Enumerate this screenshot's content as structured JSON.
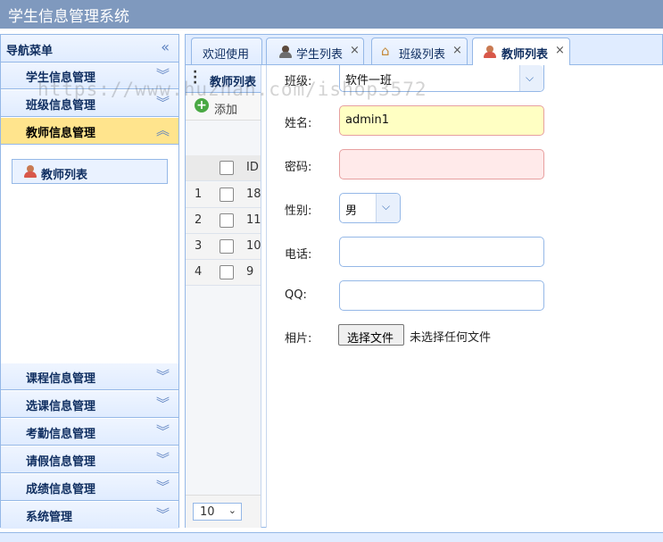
{
  "app": {
    "title": "学生信息管理系统"
  },
  "nav": {
    "header": "导航菜单",
    "top_items": [
      {
        "label": "学生信息管理"
      },
      {
        "label": "班级信息管理"
      },
      {
        "label": "教师信息管理"
      }
    ],
    "active_sub_item": "教师列表",
    "bottom_items": [
      {
        "label": "课程信息管理"
      },
      {
        "label": "选课信息管理"
      },
      {
        "label": "考勤信息管理"
      },
      {
        "label": "请假信息管理"
      },
      {
        "label": "成绩信息管理"
      },
      {
        "label": "系统管理"
      }
    ]
  },
  "tabs": [
    {
      "label": "欢迎使用"
    },
    {
      "label": "学生列表"
    },
    {
      "label": "班级列表"
    },
    {
      "label": "教师列表"
    }
  ],
  "grid": {
    "title": "教师列表",
    "add_label": "添加",
    "id_header": "ID",
    "rows": [
      {
        "num": "1",
        "id": "18"
      },
      {
        "num": "2",
        "id": "11"
      },
      {
        "num": "3",
        "id": "10"
      },
      {
        "num": "4",
        "id": "9"
      }
    ],
    "page_size": "10"
  },
  "form": {
    "class_label": "班级:",
    "class_value": "软件一班",
    "name_label": "姓名:",
    "name_value": "admin1",
    "password_label": "密码:",
    "gender_label": "性别:",
    "gender_value": "男",
    "phone_label": "电话:",
    "qq_label": "QQ:",
    "photo_label": "相片:",
    "file_button": "选择文件",
    "file_status": "未选择任何文件"
  },
  "watermark": "https://www.huzhan.com/ishop3572"
}
